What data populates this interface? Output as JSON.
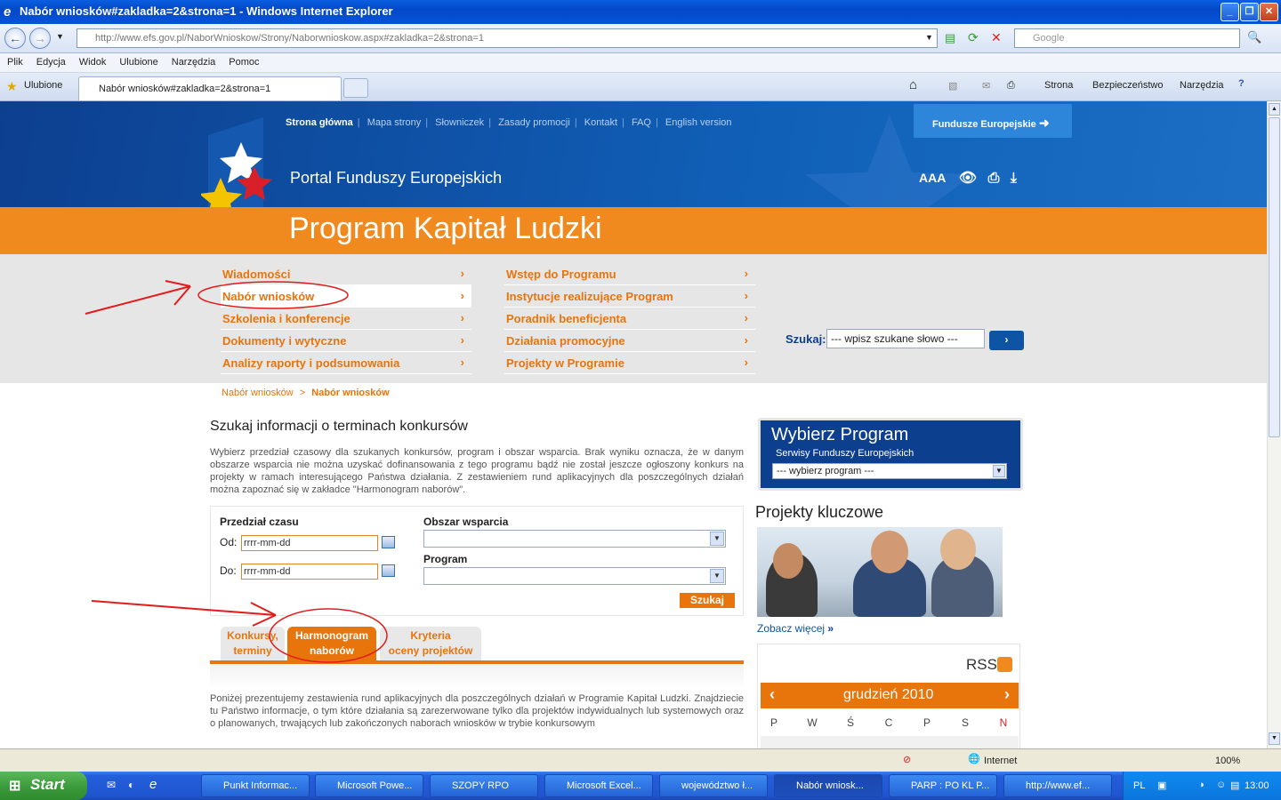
{
  "window": {
    "title": "Nabór wniosków#zakladka=2&strona=1 - Windows Internet Explorer"
  },
  "browser": {
    "url": "http://www.efs.gov.pl/NaborWnioskow/Strony/Naborwnioskow.aspx#zakladka=2&strona=1",
    "search_placeholder": "Google",
    "menu": [
      "Plik",
      "Edycja",
      "Widok",
      "Ulubione",
      "Narzędzia",
      "Pomoc"
    ],
    "favorites": "Ulubione",
    "tab_title": "Nabór wniosków#zakladka=2&strona=1",
    "toolbar": {
      "page": "Strona",
      "security": "Bezpieczeństwo",
      "tools": "Narzędzia"
    }
  },
  "site": {
    "toplinks": [
      "Strona główna",
      "Mapa strony",
      "Słowniczek",
      "Zasady promocji",
      "Kontakt",
      "FAQ",
      "English version"
    ],
    "fe_button": "Fundusze Europejskie",
    "portal_name": "Portal Funduszy Europejskich",
    "program_name": "Program Kapitał Ludzki",
    "accessibility_aa": "AAA",
    "nav_left": [
      "Wiadomości",
      "Nabór wniosków",
      "Szkolenia i konferencje",
      "Dokumenty i wytyczne",
      "Analizy raporty i podsumowania"
    ],
    "nav_right": [
      "Wstęp do Programu",
      "Instytucje realizujące Program",
      "Poradnik beneficjenta",
      "Działania promocyjne",
      "Projekty w Programie"
    ],
    "active_nav": "Nabór wniosków",
    "search_label": "Szukaj:",
    "search_placeholder": "--- wpisz szukane słowo ---",
    "search_button": "›"
  },
  "breadcrumb": {
    "parent": "Nabór wniosków",
    "sep": ">",
    "current": "Nabór wniosków"
  },
  "main": {
    "title": "Szukaj informacji o terminach konkursów",
    "intro": "Wybierz przedział czasowy dla szukanych konkursów, program i obszar wsparcia. Brak wyniku oznacza, że w danym obszarze wsparcia nie można uzyskać dofinansowania z tego programu bądź nie został jeszcze ogłoszony konkurs na projekty w ramach interesującego Państwa działania. Z zestawieniem rund aplikacyjnych dla poszczególnych działań można zapoznać się w zakładce \"Harmonogram naborów\".",
    "form": {
      "period_label": "Przedział czasu",
      "from_label": "Od:",
      "to_label": "Do:",
      "date_placeholder": "rrrr-mm-dd",
      "area_label": "Obszar wsparcia",
      "program_label": "Program",
      "submit": "Szukaj"
    },
    "tabs": [
      {
        "line1": "Konkursy,",
        "line2": "terminy"
      },
      {
        "line1": "Harmonogram",
        "line2": "naborów"
      },
      {
        "line1": "Kryteria",
        "line2": "oceny projektów"
      }
    ],
    "paragraph": "Poniżej prezentujemy zestawienia rund aplikacyjnych dla poszczególnych działań w Programie Kapitał Ludzki. Znajdziecie tu Państwo informacje, o tym które działania są zarezerwowane tylko dla projektów indywidualnych lub systemowych oraz o planowanych, trwających lub zakończonych naborach wniosków w trybie konkursowym"
  },
  "sidebar": {
    "choose_title": "Wybierz Program",
    "choose_sub": "Serwisy Funduszy Europejskich",
    "choose_select": "--- wybierz program ---",
    "key_projects": "Projekty kluczowe",
    "see_more": "Zobacz więcej",
    "rss": "RSS",
    "calendar_month": "grudzień 2010",
    "weekdays": [
      "P",
      "W",
      "Ś",
      "C",
      "P",
      "S",
      "N"
    ]
  },
  "status": {
    "zone": "Internet",
    "zoom": "100%"
  },
  "taskbar": {
    "start": "Start",
    "tasks": [
      "Punkt Informac...",
      "Microsoft Powe...",
      "SZOPY RPO",
      "Microsoft Excel...",
      "województwo ł...",
      "Nabór wniosk...",
      "PARP : PO KL P...",
      "http://www.ef..."
    ],
    "lang": "PL",
    "time": "13:00"
  },
  "colors": {
    "orange": "#e8740c",
    "navy": "#0d3f8f",
    "header_blue": "#1060b8",
    "annotation_red": "#e31b1b"
  }
}
